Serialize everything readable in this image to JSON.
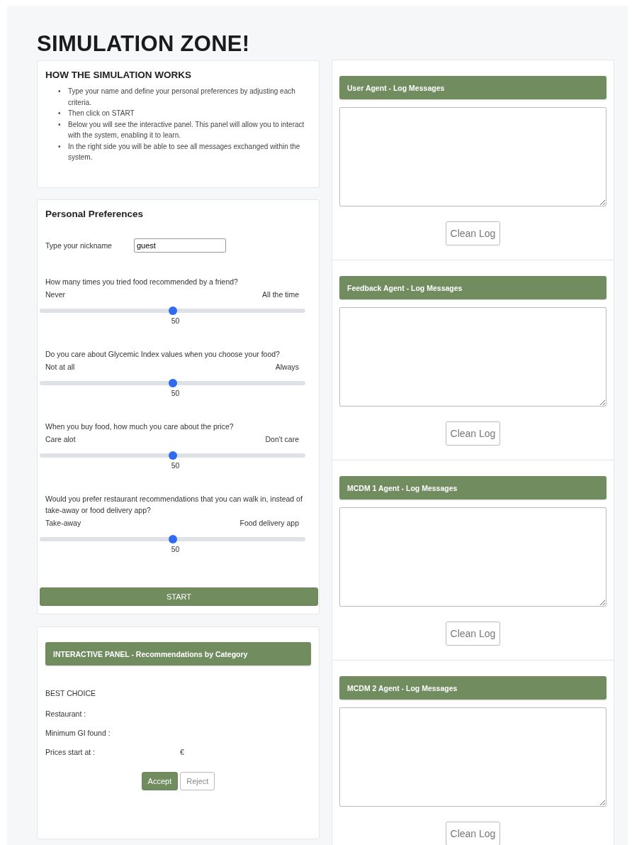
{
  "title": "SIMULATION ZONE!",
  "how_it_works": {
    "heading": "HOW THE SIMULATION WORKS",
    "items": [
      {
        "marker": "•",
        "text": "Type your name and define your personal preferences by adjusting each criteria."
      },
      {
        "marker": "•",
        "text": "Then click on START"
      },
      {
        "marker": "•",
        "text": "Below you will see the interactive panel. This panel will allow you to interact with the system, enabling it to learn."
      },
      {
        "marker": "•",
        "text": "In the right side you will be able to see all messages exchanged within the system."
      }
    ]
  },
  "preferences": {
    "heading": "Personal Preferences",
    "nickname": {
      "label": "Type your nickname",
      "value": "guest"
    },
    "sliders": [
      {
        "question": "How many times you tried food recommended by a friend?",
        "min_label": "Never",
        "max_label": "All the time",
        "level": 0.5,
        "reading": "50"
      },
      {
        "question": "Do you care about Glycemic Index values when you choose your food?",
        "min_label": "Not at all",
        "max_label": "Always",
        "level": 0.5,
        "reading": "50"
      },
      {
        "question": "When you buy food, how much you care about the price?",
        "min_label": "Care alot",
        "max_label": "Don't care",
        "level": 0.5,
        "reading": "50"
      },
      {
        "question": "Would you prefer restaurant recommendations that you can walk in, instead of take-away or food delivery app?",
        "min_label": "Take-away",
        "max_label": "Food delivery app",
        "level": 0.5,
        "reading": "50"
      }
    ],
    "start_button": "START"
  },
  "interactive_panel": {
    "header": "INTERACTIVE PANEL - Recommendations by Category",
    "section": "BEST CHOICE",
    "fields": [
      {
        "label": "Restaurant :"
      },
      {
        "label": "Minimum GI found :"
      },
      {
        "label": "Prices start at :",
        "value": "€"
      }
    ],
    "accept_button": "Accept",
    "reject_button": "Reject"
  },
  "log_panels": [
    {
      "header": "User Agent - Log Messages",
      "button": "Clean Log"
    },
    {
      "header": "Feedback Agent - Log Messages",
      "button": "Clean Log"
    },
    {
      "header": "MCDM 1 Agent - Log Messages",
      "button": "Clean Log"
    },
    {
      "header": "MCDM 2 Agent - Log Messages",
      "button": "Clean Log"
    }
  ]
}
